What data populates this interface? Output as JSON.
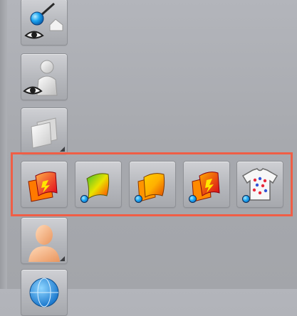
{
  "toolbar": {
    "tools": [
      {
        "icon": "blue-point-eye-icon"
      },
      {
        "icon": "avatar-eye-icon"
      },
      {
        "icon": "sheets-icon",
        "has_flyout": true
      },
      {
        "icon": "avatar-skin-icon",
        "has_flyout": true
      },
      {
        "icon": "globe-icon"
      }
    ]
  },
  "flyout": {
    "highlight_color": "#f05e46",
    "tools": [
      {
        "icon": "fabric-red-yellow-icon"
      },
      {
        "icon": "fabric-green-yellow-icon",
        "has_dot": true
      },
      {
        "icon": "fabric-orange-yellow-icon",
        "has_dot": true
      },
      {
        "icon": "fabric-red-lightning-icon",
        "has_dot": true
      },
      {
        "icon": "shirt-dots-icon",
        "has_dot": true
      }
    ]
  }
}
